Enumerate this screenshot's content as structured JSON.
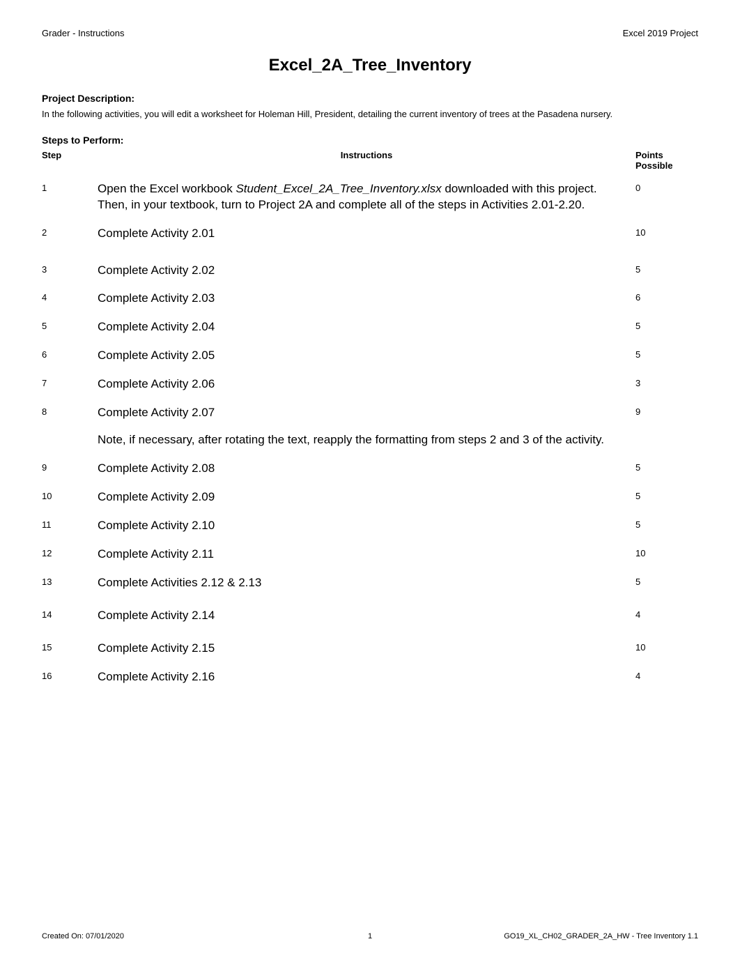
{
  "header": {
    "left": "Grader - Instructions",
    "right": "Excel 2019 Project"
  },
  "title": "Excel_2A_Tree_Inventory",
  "project_description": {
    "label": "Project Description:",
    "text": "In the following activities, you will edit a worksheet for Holeman Hill, President, detailing the current inventory of trees at the Pasadena nursery."
  },
  "steps_label": "Steps to Perform:",
  "table_header": {
    "step": "Step",
    "instructions": "Instructions",
    "points": "Points Possible"
  },
  "steps": [
    {
      "num": "1",
      "instr_pre": "Open the Excel workbook ",
      "instr_italic": "Student_Excel_2A_Tree_Inventory.xlsx",
      "instr_post": " downloaded with this project. Then, in your textbook, turn to Project 2A and complete all of the steps in Activities 2.01-2.20.",
      "points": "0"
    },
    {
      "num": "2",
      "instr": "Complete Activity 2.01",
      "points": "10"
    },
    {
      "num": "3",
      "instr": "Complete Activity 2.02",
      "points": "5"
    },
    {
      "num": "4",
      "instr": "Complete Activity 2.03",
      "points": "6"
    },
    {
      "num": "5",
      "instr": "Complete Activity 2.04",
      "points": "5"
    },
    {
      "num": "6",
      "instr": "Complete Activity 2.05",
      "points": "5"
    },
    {
      "num": "7",
      "instr": "Complete Activity 2.06",
      "points": "3"
    },
    {
      "num": "8",
      "instr": "Complete Activity 2.07",
      "note": "Note, if necessary, after rotating the text, reapply the formatting from steps 2 and 3 of the activity.",
      "points": "9"
    },
    {
      "num": "9",
      "instr": "Complete Activity 2.08",
      "points": "5"
    },
    {
      "num": "10",
      "instr": "Complete Activity 2.09",
      "points": "5"
    },
    {
      "num": "11",
      "instr": "Complete Activity 2.10",
      "points": "5"
    },
    {
      "num": "12",
      "instr": "Complete Activity 2.11",
      "points": "10"
    },
    {
      "num": "13",
      "instr": "Complete Activities 2.12 & 2.13",
      "points": "5"
    },
    {
      "num": "14",
      "instr": "Complete Activity 2.14",
      "points": "4"
    },
    {
      "num": "15",
      "instr": "Complete Activity 2.15",
      "points": "10"
    },
    {
      "num": "16",
      "instr": "Complete Activity 2.16",
      "points": "4"
    }
  ],
  "footer": {
    "left": "Created On: 07/01/2020",
    "center": "1",
    "right": "GO19_XL_CH02_GRADER_2A_HW - Tree Inventory 1.1"
  }
}
